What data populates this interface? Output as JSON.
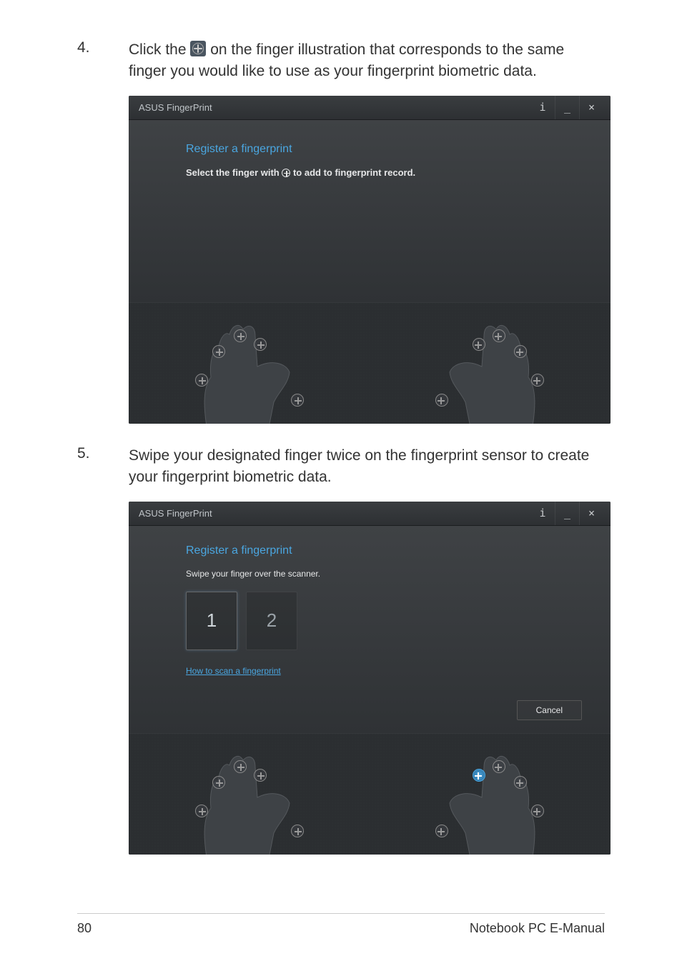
{
  "steps": {
    "s4": {
      "num": "4.",
      "before": "Click the ",
      "after": " on the finger illustration that corresponds to the same finger you would like to use as your fingerprint biometric data."
    },
    "s5": {
      "num": "5.",
      "text": "Swipe your designated finger twice on the fingerprint sensor to create your fingerprint biometric data."
    }
  },
  "app": {
    "title": "ASUS FingerPrint",
    "info_glyph": "i",
    "min_glyph": "_",
    "close_glyph": "×",
    "screen1": {
      "heading": "Register a fingerprint",
      "sub_before": "Select the finger with ",
      "sub_after": " to add to fingerprint record."
    },
    "screen2": {
      "heading": "Register a fingerprint",
      "sub": "Swipe your finger over the scanner.",
      "box1": "1",
      "box2": "2",
      "howto": "How to scan a fingerprint",
      "cancel": "Cancel"
    }
  },
  "footer": {
    "page": "80",
    "book": "Notebook PC E-Manual"
  }
}
